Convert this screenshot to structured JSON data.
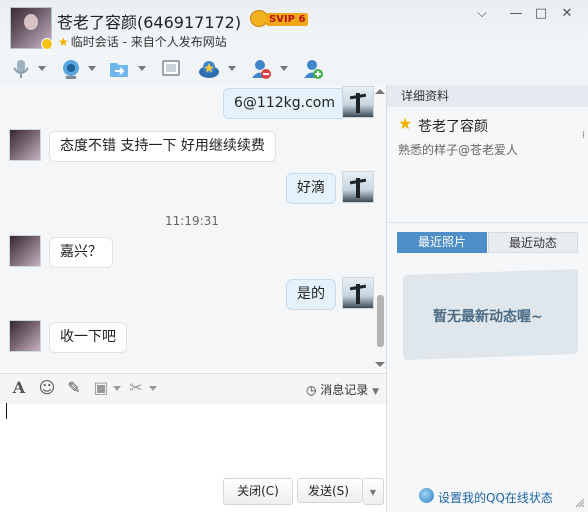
{
  "window": {
    "contact_name": "苍老了容颜(646917172)",
    "vip_label": "SVIP 6",
    "session_type": "临时会话 - 来自个人发布网站",
    "controls": [
      "⌵",
      "—",
      "□",
      "✕"
    ]
  },
  "toolbar": {
    "icons": [
      "microphone-icon",
      "webcam-icon",
      "file-transfer-icon",
      "screen-share-icon",
      "app-center-icon",
      "remove-contact-icon",
      "add-contact-icon"
    ]
  },
  "chat": {
    "messages": [
      {
        "side": "right",
        "text": "6@112kg.com"
      },
      {
        "side": "left",
        "text": "态度不错 支持一下 好用继续续费"
      },
      {
        "side": "right",
        "text": "好滴"
      },
      {
        "side": "left",
        "text": "嘉兴？"
      },
      {
        "side": "right",
        "text": "是的"
      },
      {
        "side": "left",
        "text": "收一下吧"
      }
    ],
    "timestamp": "11:19:31"
  },
  "input": {
    "history_label": "消息记录",
    "close_label": "关闭(C)",
    "send_label": "发送(S)"
  },
  "side": {
    "header": "详细资料",
    "name": "苍老了容颜",
    "signature": "熟悉的样子@苍老爱人",
    "tab_recent_photos": "最近照片",
    "tab_recent_updates": "最近动态",
    "empty_text": "暂无最新动态喔~",
    "online_status_link": "设置我的QQ在线状态"
  },
  "colors": {
    "accent": "#4e8fc9",
    "link": "#1d64a8"
  }
}
